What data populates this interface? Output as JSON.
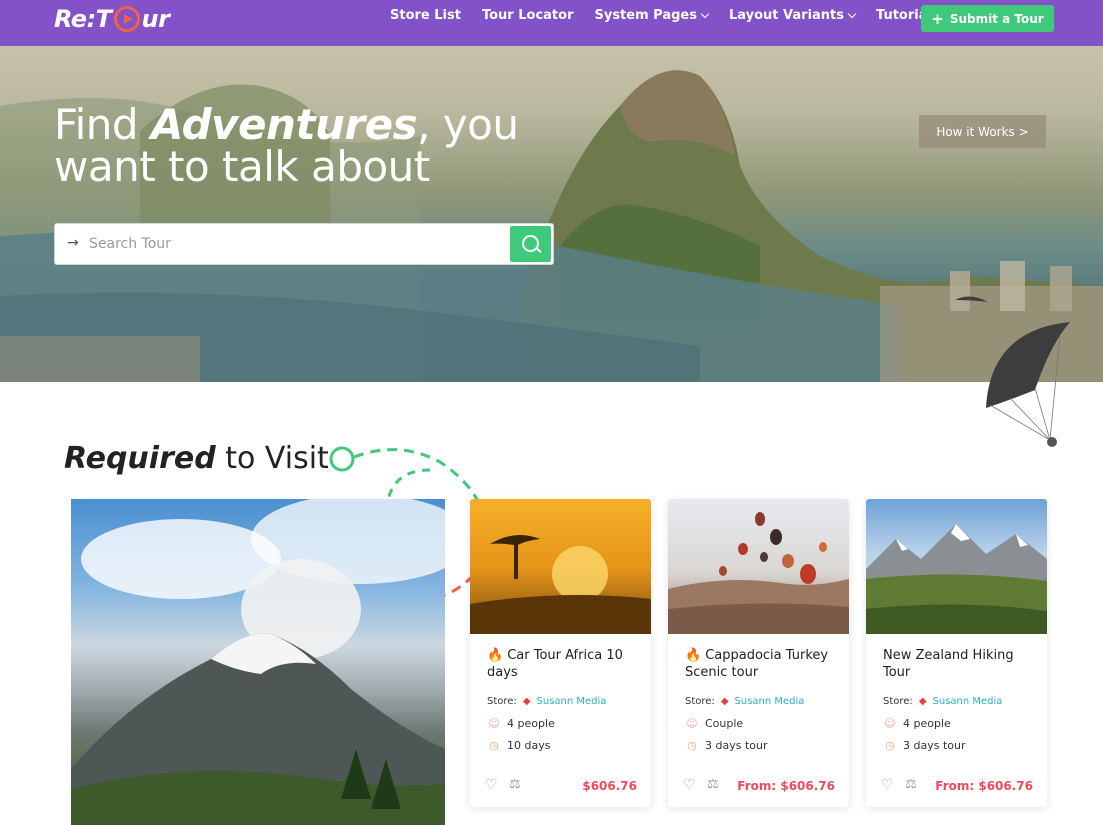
{
  "nav": {
    "logo_text_left": "Re:T",
    "logo_text_right": "ur",
    "menu": [
      {
        "label": "Store List",
        "dropdown": false
      },
      {
        "label": "Tour Locator",
        "dropdown": false
      },
      {
        "label": "System Pages",
        "dropdown": true
      },
      {
        "label": "Layout Variants",
        "dropdown": true
      },
      {
        "label": "Tutorials",
        "dropdown": false
      }
    ],
    "submit_label": "Submit a Tour",
    "colors": {
      "bar": "#8352c9",
      "accent": "#3ec97b",
      "logo_o": "#f0604a"
    }
  },
  "hero": {
    "title_part1": "Find ",
    "title_em": "Adventures",
    "title_part2": ", you",
    "title_line2": "want to talk about",
    "how_label": "How it Works >",
    "search": {
      "placeholder": "Search Tour",
      "value": ""
    }
  },
  "section": {
    "title_em": "Required",
    "title_rest": " to Visit"
  },
  "cards": [
    {
      "title": "Car Tour Africa 10 days",
      "hot": true,
      "store_label": "Store:",
      "store_name": "Susann Media",
      "people": "4 people",
      "duration": "10 days",
      "price": "$606.76",
      "image": "savanna-sunset"
    },
    {
      "title": "Cappadocia Turkey Scenic tour",
      "hot": true,
      "store_label": "Store:",
      "store_name": "Susann Media",
      "people": "Couple",
      "duration": "3 days tour",
      "price": "From: $606.76",
      "image": "hot-air-balloons"
    },
    {
      "title": "New Zealand Hiking Tour",
      "hot": false,
      "store_label": "Store:",
      "store_name": "Susann Media",
      "people": "4 people",
      "duration": "3 days tour",
      "price": "From: $606.76",
      "image": "snowy-mountains"
    }
  ],
  "colors": {
    "price": "#ef4b5a",
    "store_link": "#2ab0c4",
    "fire": "#e8403a"
  }
}
